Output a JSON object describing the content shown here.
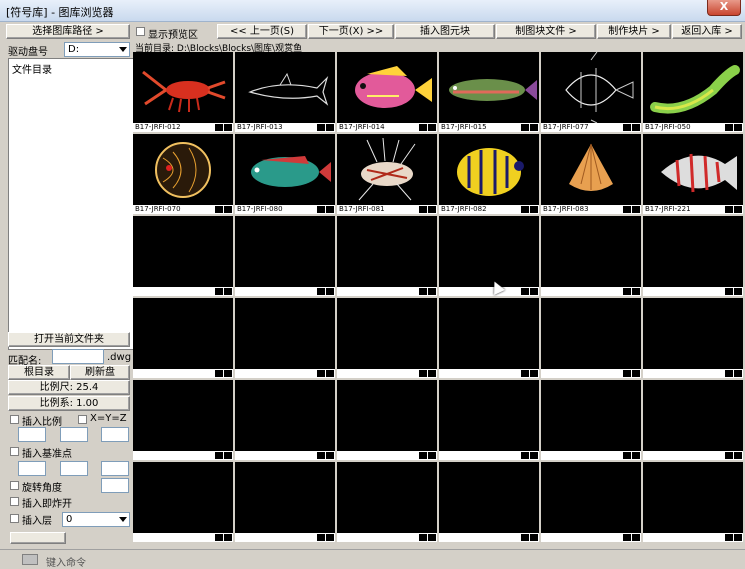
{
  "window": {
    "title": "[符号库] - 图库浏览器",
    "close_label": "X"
  },
  "left": {
    "select_path_btn": "选择图库路径 >",
    "drive_label": "驱动盘号",
    "drive_value": "D:",
    "folder_label": "文件目录",
    "open_folder_btn": "打开当前文件夹",
    "pattern_label": "匹配名:",
    "pattern_ext": ".dwg",
    "root_dir_btn": "根目录",
    "refresh_btn": "刷新盘",
    "scale_btn": "比例尺: 25.4",
    "ratio_btn": "比例系: 1.00",
    "insert_scale_label": "插入比例",
    "xyz_label": "X=Y=Z",
    "insert_point_label": "插入基准点",
    "rotate_label": "旋转角度",
    "explode_label": "插入即炸开",
    "layer_label": "插入层",
    "layer_value": "0"
  },
  "toolbar": {
    "show_preview": "显示预览区",
    "prev_page": "<< 上一页(S)",
    "next_page": "下一页(X) >>",
    "insert_block": "插入图元块",
    "block_file": "制图块文件 >",
    "make_block": "制作块片 >",
    "exit": "返回入库 >"
  },
  "path": {
    "label": "当前目录:",
    "value": "D:\\Blocks\\Blocks\\图库\\观赏鱼"
  },
  "thumbnails": [
    {
      "caption": "B17-JRFI-012",
      "subject": "lobster"
    },
    {
      "caption": "B17-JRFI-013",
      "subject": "shark"
    },
    {
      "caption": "B17-JRFI-014",
      "subject": "reef-fish"
    },
    {
      "caption": "B17-JRFI-015",
      "subject": "trout"
    },
    {
      "caption": "B17-JRFI-077",
      "subject": "angelfish"
    },
    {
      "caption": "B17-JRFI-050",
      "subject": "arowana"
    },
    {
      "caption": "B17-JRFI-070",
      "subject": "discus"
    },
    {
      "caption": "B17-JRFI-080",
      "subject": "cichlid"
    },
    {
      "caption": "B17-JRFI-081",
      "subject": "lionfish"
    },
    {
      "caption": "B17-JRFI-082",
      "subject": "butterflyfish"
    },
    {
      "caption": "B17-JRFI-083",
      "subject": "shell"
    },
    {
      "caption": "B17-JRFI-221",
      "subject": "striped-fish"
    }
  ],
  "status": {
    "text": "键入命令"
  },
  "colors": {
    "window_bg": "#d4d0c8",
    "thumb_bg": "#000000"
  }
}
